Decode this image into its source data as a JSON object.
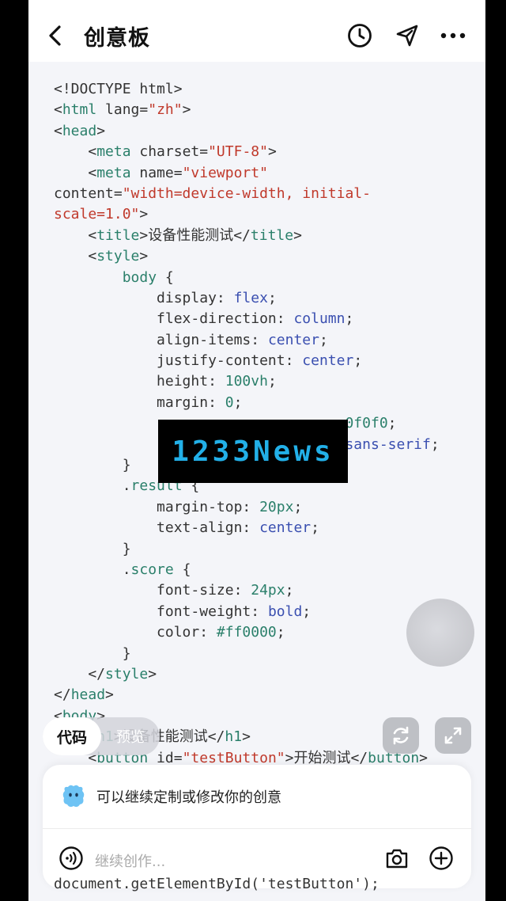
{
  "header": {
    "title": "创意板"
  },
  "code_lines": [
    [
      {
        "t": "<!DOCTYPE html>",
        "c": "attr"
      }
    ],
    [
      {
        "t": "<",
        "c": "attr"
      },
      {
        "t": "html",
        "c": "tag"
      },
      {
        "t": " lang=",
        "c": "attr"
      },
      {
        "t": "\"zh\"",
        "c": "str"
      },
      {
        "t": ">",
        "c": "attr"
      }
    ],
    [
      {
        "t": "<",
        "c": "attr"
      },
      {
        "t": "head",
        "c": "tag"
      },
      {
        "t": ">",
        "c": "attr"
      }
    ],
    [
      {
        "t": "    <",
        "c": "attr"
      },
      {
        "t": "meta",
        "c": "tag"
      },
      {
        "t": " charset=",
        "c": "attr"
      },
      {
        "t": "\"UTF-8\"",
        "c": "str"
      },
      {
        "t": ">",
        "c": "attr"
      }
    ],
    [
      {
        "t": "    <",
        "c": "attr"
      },
      {
        "t": "meta",
        "c": "tag"
      },
      {
        "t": " name=",
        "c": "attr"
      },
      {
        "t": "\"viewport\"",
        "c": "str"
      }
    ],
    [
      {
        "t": "content=",
        "c": "attr"
      },
      {
        "t": "\"width=device-width, initial-",
        "c": "str"
      }
    ],
    [
      {
        "t": "scale=1.0\"",
        "c": "str"
      },
      {
        "t": ">",
        "c": "attr"
      }
    ],
    [
      {
        "t": "    <",
        "c": "attr"
      },
      {
        "t": "title",
        "c": "tag"
      },
      {
        "t": ">设备性能测试</",
        "c": "attr"
      },
      {
        "t": "title",
        "c": "tag"
      },
      {
        "t": ">",
        "c": "attr"
      }
    ],
    [
      {
        "t": "    <",
        "c": "attr"
      },
      {
        "t": "style",
        "c": "tag"
      },
      {
        "t": ">",
        "c": "attr"
      }
    ],
    [
      {
        "t": "        ",
        "c": "attr"
      },
      {
        "t": "body",
        "c": "kw"
      },
      {
        "t": " {",
        "c": "attr"
      }
    ],
    [
      {
        "t": "            display: ",
        "c": "attr"
      },
      {
        "t": "flex",
        "c": "val"
      },
      {
        "t": ";",
        "c": "attr"
      }
    ],
    [
      {
        "t": "            flex-direction: ",
        "c": "attr"
      },
      {
        "t": "column",
        "c": "val"
      },
      {
        "t": ";",
        "c": "attr"
      }
    ],
    [
      {
        "t": "            align-items: ",
        "c": "attr"
      },
      {
        "t": "center",
        "c": "val"
      },
      {
        "t": ";",
        "c": "attr"
      }
    ],
    [
      {
        "t": "            justify-content: ",
        "c": "attr"
      },
      {
        "t": "center",
        "c": "val"
      },
      {
        "t": ";",
        "c": "attr"
      }
    ],
    [
      {
        "t": "            height: ",
        "c": "attr"
      },
      {
        "t": "100vh",
        "c": "num"
      },
      {
        "t": ";",
        "c": "attr"
      }
    ],
    [
      {
        "t": "            margin: ",
        "c": "attr"
      },
      {
        "t": "0",
        "c": "num"
      },
      {
        "t": ";",
        "c": "attr"
      }
    ],
    [
      {
        "t": "                                  ",
        "c": "attr"
      },
      {
        "t": "0f0f0",
        "c": "num"
      },
      {
        "t": ";",
        "c": "attr"
      }
    ],
    [
      {
        "t": "                                  ",
        "c": "attr"
      },
      {
        "t": "sans-serif",
        "c": "val"
      },
      {
        "t": ";",
        "c": "attr"
      }
    ],
    [
      {
        "t": "        }",
        "c": "attr"
      }
    ],
    [
      {
        "t": "        .",
        "c": "attr"
      },
      {
        "t": "result",
        "c": "kw"
      },
      {
        "t": " {",
        "c": "attr"
      }
    ],
    [
      {
        "t": "            margin-top: ",
        "c": "attr"
      },
      {
        "t": "20px",
        "c": "num"
      },
      {
        "t": ";",
        "c": "attr"
      }
    ],
    [
      {
        "t": "            text-align: ",
        "c": "attr"
      },
      {
        "t": "center",
        "c": "val"
      },
      {
        "t": ";",
        "c": "attr"
      }
    ],
    [
      {
        "t": "        }",
        "c": "attr"
      }
    ],
    [
      {
        "t": "        .",
        "c": "attr"
      },
      {
        "t": "score",
        "c": "kw"
      },
      {
        "t": " {",
        "c": "attr"
      }
    ],
    [
      {
        "t": "            font-size: ",
        "c": "attr"
      },
      {
        "t": "24px",
        "c": "num"
      },
      {
        "t": ";",
        "c": "attr"
      }
    ],
    [
      {
        "t": "            font-weight: ",
        "c": "attr"
      },
      {
        "t": "bold",
        "c": "val"
      },
      {
        "t": ";",
        "c": "attr"
      }
    ],
    [
      {
        "t": "            color: ",
        "c": "attr"
      },
      {
        "t": "#ff0000",
        "c": "num"
      },
      {
        "t": ";",
        "c": "attr"
      }
    ],
    [
      {
        "t": "        }",
        "c": "attr"
      }
    ],
    [
      {
        "t": "    </",
        "c": "attr"
      },
      {
        "t": "style",
        "c": "tag"
      },
      {
        "t": ">",
        "c": "attr"
      }
    ],
    [
      {
        "t": "</",
        "c": "attr"
      },
      {
        "t": "head",
        "c": "tag"
      },
      {
        "t": ">",
        "c": "attr"
      }
    ],
    [
      {
        "t": "<",
        "c": "attr"
      },
      {
        "t": "body",
        "c": "tag"
      },
      {
        "t": ">",
        "c": "attr"
      }
    ],
    [
      {
        "t": "    <",
        "c": "attr"
      },
      {
        "t": "h1",
        "c": "tag"
      },
      {
        "t": ">设备性能测试</",
        "c": "attr"
      },
      {
        "t": "h1",
        "c": "tag"
      },
      {
        "t": ">",
        "c": "attr"
      }
    ],
    [
      {
        "t": "    <",
        "c": "attr"
      },
      {
        "t": "button",
        "c": "tag"
      },
      {
        "t": " id=",
        "c": "attr"
      },
      {
        "t": "\"testButton\"",
        "c": "str"
      },
      {
        "t": ">开始测试</",
        "c": "attr"
      },
      {
        "t": "button",
        "c": "tag"
      },
      {
        "t": ">",
        "c": "attr"
      }
    ]
  ],
  "watermark": {
    "text": "1233News"
  },
  "view_tabs": {
    "code": "代码",
    "preview": "预览"
  },
  "prompt_panel": {
    "suggestion": "可以继续定制或修改你的创意",
    "input_placeholder": "继续创作..."
  },
  "bottom_peek": "document.getElementById('testButton');",
  "icons": {
    "back": "chevron-left-icon",
    "history": "clock-icon",
    "share": "send-icon",
    "more": "more-dots-icon",
    "refresh": "refresh-icon",
    "expand": "expand-icon",
    "assistant": "assistant-avatar-icon",
    "voice": "voice-icon",
    "camera": "camera-icon",
    "add": "plus-circle-icon"
  }
}
